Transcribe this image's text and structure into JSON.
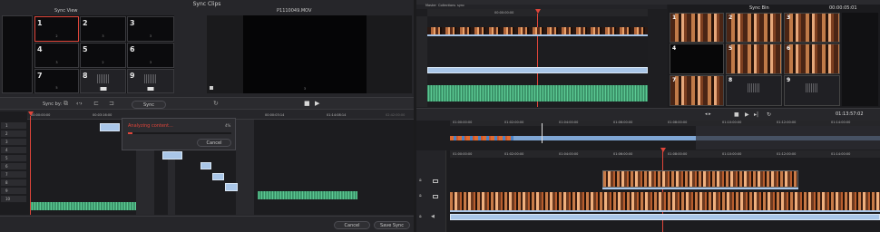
{
  "sync_clips": {
    "title": "Sync Clips",
    "sync_view_label": "Sync View",
    "preview_title": "P1110049.MOV",
    "preview_number": "3",
    "grid": [
      {
        "n": "1",
        "sub": "2"
      },
      {
        "n": "2",
        "sub": "3"
      },
      {
        "n": "3",
        "sub": "3"
      },
      {
        "n": "4",
        "sub": "3"
      },
      {
        "n": "5",
        "sub": "2"
      },
      {
        "n": "6",
        "sub": "3"
      },
      {
        "n": "7",
        "sub": "5"
      },
      {
        "n": "8",
        "sub": ""
      },
      {
        "n": "9",
        "sub": ""
      }
    ],
    "sync_by_label": "Sync by:",
    "sync_button": "Sync",
    "timecodes": [
      "00:00:00:00",
      "00:03:16:00",
      "00:00:03:14",
      "01:14:08:14",
      "02:42:00:00"
    ],
    "track_labels": [
      "1",
      "2",
      "3",
      "4",
      "5",
      "6",
      "7",
      "8",
      "9",
      "10"
    ],
    "progress": {
      "text": "Analyzing content...",
      "percent": "4%",
      "cancel": "Cancel",
      "value": 0.04
    },
    "cancel_label": "Cancel",
    "save_sync_label": "Save Sync"
  },
  "editor": {
    "tabs": [
      "Master",
      "Collections",
      "sync"
    ],
    "top_timecode": "00:00:00:00",
    "sync_bin_title": "Sync Bin",
    "sync_bin_timecode": "00:00:05:01",
    "viewer_timecode": "01:13:57:02",
    "bin_cells": [
      "1",
      "2",
      "3",
      "4",
      "5",
      "6",
      "7",
      "8",
      "9"
    ],
    "ruler_marks": [
      "01:00:00:00",
      "01:02:00:00",
      "01:04:00:00",
      "01:06:00:00",
      "01:08:00:00",
      "01:10:00:00",
      "01:12:00:00",
      "01:14:00:00"
    ],
    "timeline_marks": [
      "01:00:00:00",
      "01:02:00:00",
      "01:04:00:00",
      "01:06:00:00",
      "01:08:00:00",
      "01:10:00:00",
      "01:12:00:00",
      "01:14:00:00"
    ]
  },
  "colors": {
    "accent_red": "#e0453a",
    "wave_green": "#5cc994",
    "clip_blue": "#a9c6e8"
  }
}
